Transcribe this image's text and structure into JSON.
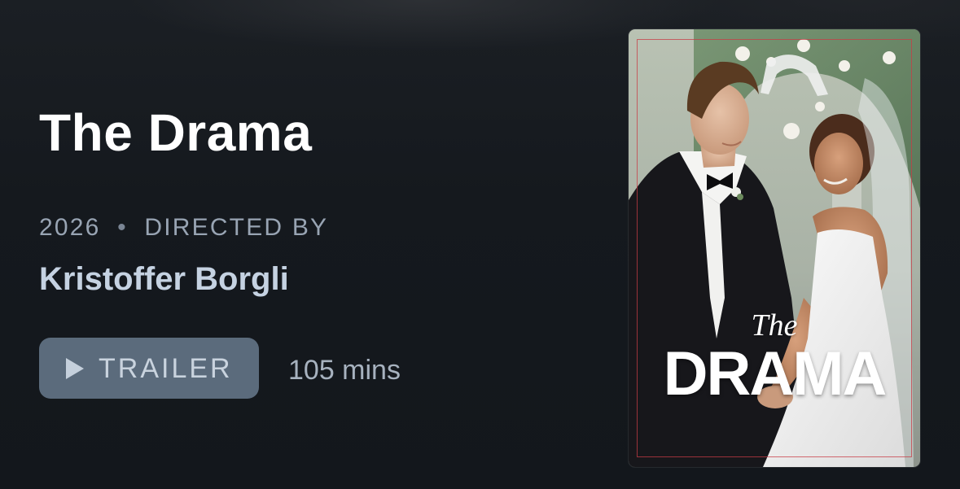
{
  "movie": {
    "title": "The Drama",
    "year": "2026",
    "separator": "•",
    "directed_by_label": "DIRECTED BY",
    "director": "Kristoffer Borgli",
    "trailer_label": "TRAILER",
    "runtime": "105 mins"
  },
  "poster": {
    "title_small": "The",
    "title_large": "DRAMA",
    "description": "Movie poster: groom in black tuxedo and bride in white gown with veil holding hands in front of a floral arch"
  },
  "icons": {
    "trailer_icon": "play-icon"
  },
  "colors": {
    "background": "#14181d",
    "title": "#ffffff",
    "meta": "#98a4b3",
    "director": "#c5d2e2",
    "button_bg": "#5b6b7c",
    "button_text": "#c9d3de",
    "runtime": "#a7b2bf"
  }
}
